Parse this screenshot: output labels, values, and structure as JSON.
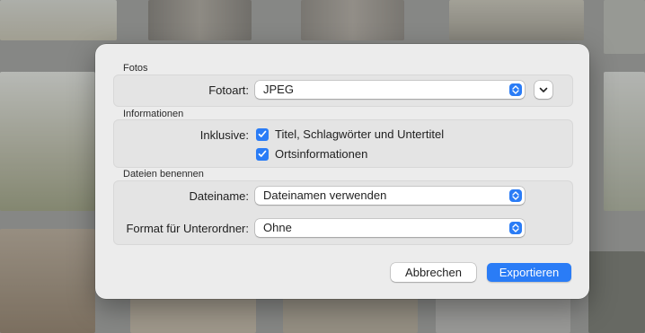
{
  "sections": {
    "photos": {
      "title": "Fotos",
      "photo_kind_label": "Fotoart:",
      "photo_kind_value": "JPEG"
    },
    "info": {
      "title": "Informationen",
      "include_label": "Inklusive:",
      "options": [
        {
          "label": "Titel, Schlagwörter und Untertitel",
          "checked": true
        },
        {
          "label": "Ortsinformationen",
          "checked": true
        }
      ]
    },
    "naming": {
      "title": "Dateien benennen",
      "filename_label": "Dateiname:",
      "filename_value": "Dateinamen verwenden",
      "subfolder_label": "Format für Unterordner:",
      "subfolder_value": "Ohne"
    }
  },
  "buttons": {
    "cancel": "Abbrechen",
    "export": "Exportieren"
  },
  "colors": {
    "accent": "#2a7cf6",
    "dialog_bg": "#ececec"
  },
  "icons": [
    "chevron-updown-icon",
    "chevron-down-icon",
    "checkmark-icon"
  ]
}
